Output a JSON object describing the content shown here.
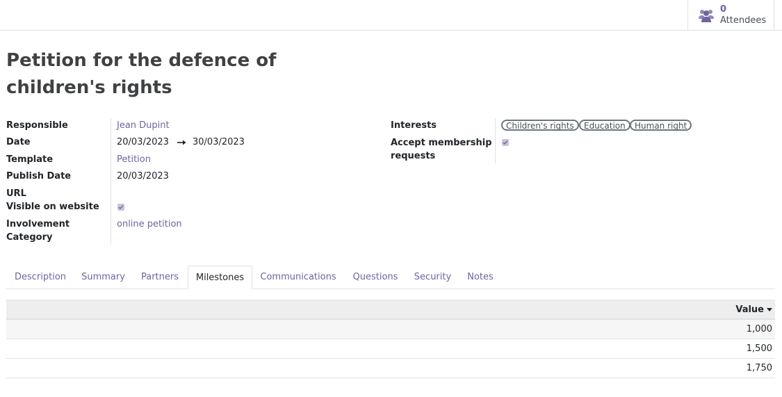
{
  "stat": {
    "value": "0",
    "label": "Attendees",
    "icon": "users-icon"
  },
  "title": "Petition for the defence of children's rights",
  "fields_left": {
    "responsible_label": "Responsible",
    "responsible_value": "Jean Dupint",
    "date_label": "Date",
    "date_start": "20/03/2023",
    "date_end": "30/03/2023",
    "template_label": "Template",
    "template_value": "Petition",
    "publish_label": "Publish Date",
    "publish_value": "20/03/2023",
    "url_label": "URL",
    "visible_label": "Visible on website",
    "visible_checked": true,
    "involvement_label_1": "Involvement",
    "involvement_label_2": "Category",
    "involvement_value": "online petition"
  },
  "fields_right": {
    "interests_label": "Interests",
    "interests_tags": [
      "Children's rights",
      "Education",
      "Human right"
    ],
    "membership_label_1": "Accept membership",
    "membership_label_2": "requests",
    "membership_checked": true
  },
  "tabs": [
    "Description",
    "Summary",
    "Partners",
    "Milestones",
    "Communications",
    "Questions",
    "Security",
    "Notes"
  ],
  "active_tab": "Milestones",
  "table": {
    "column": "Value",
    "rows": [
      "1,000",
      "1,500",
      "1,750"
    ]
  },
  "colors": {
    "accent": "#71639e",
    "checkbox": "#c9c3dd"
  }
}
